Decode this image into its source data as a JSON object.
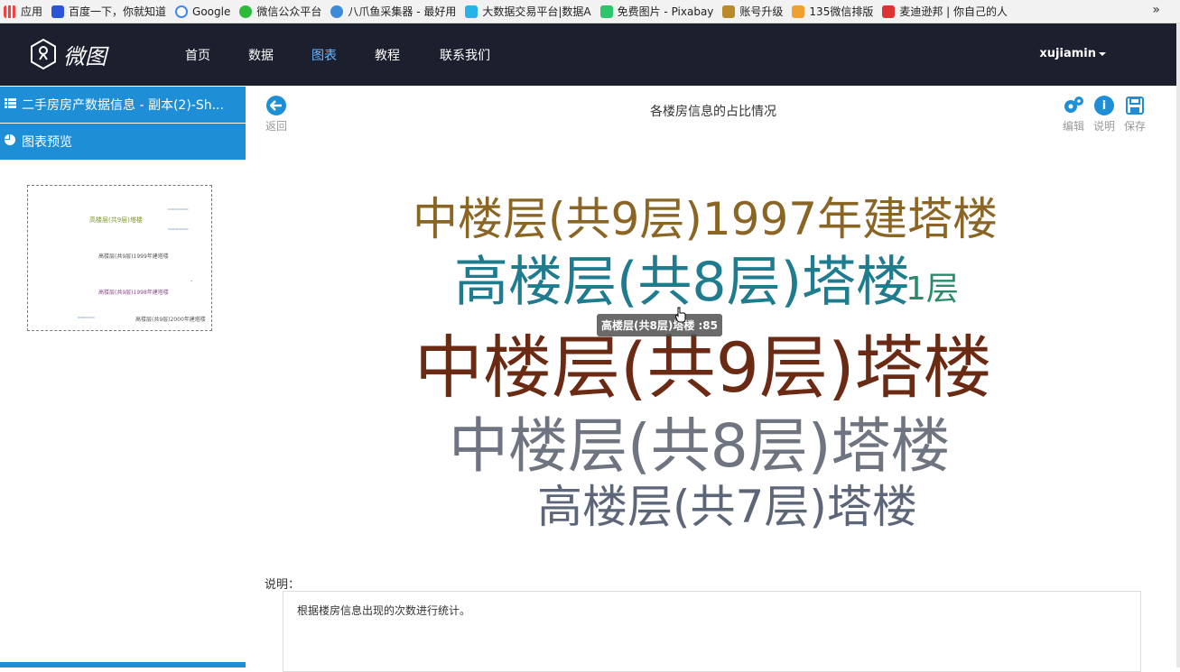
{
  "bookmarks": [
    {
      "label": "应用",
      "color": "#e44"
    },
    {
      "label": "百度一下，你就知道",
      "color": "#2b55d6"
    },
    {
      "label": "Google",
      "color": "#4285f4"
    },
    {
      "label": "微信公众平台",
      "color": "#2dbb3c"
    },
    {
      "label": "八爪鱼采集器 - 最好用",
      "color": "#3c8ad8"
    },
    {
      "label": "大数据交易平台|数据A",
      "color": "#2ab1e8"
    },
    {
      "label": "免费图片 - Pixabay",
      "color": "#2ec66d"
    },
    {
      "label": "账号升级",
      "color": "#b88a2a"
    },
    {
      "label": "135微信排版",
      "color": "#f0a030"
    },
    {
      "label": "麦迪逊邦 | 你自己的人",
      "color": "#d33"
    }
  ],
  "nav": {
    "logo_text": "微图",
    "links": [
      "首页",
      "数据",
      "图表",
      "教程",
      "联系我们"
    ],
    "active": "图表",
    "user": "xujiamin"
  },
  "sidebar": {
    "dataset_title": "二手房房产数据信息 - 副本(2)-Sh...",
    "preview_label": "图表预览",
    "thumb_words": [
      "高楼层(共9层)塔楼",
      "高楼层(共9层)1999年建塔楼",
      "高楼层(共9层)1998年建塔楼",
      "高楼层(共9层)2000年建塔楼"
    ]
  },
  "toolbar": {
    "back_label": "返回",
    "title": "各楼房信息的占比情况",
    "edit_label": "编辑",
    "desc_label": "说明",
    "save_label": "保存"
  },
  "chart_data": {
    "type": "wordcloud",
    "title": "各楼房信息的占比情况",
    "words": [
      {
        "text": "中楼层(共9层)1997年建塔楼",
        "color": "#8b6524"
      },
      {
        "text": "高楼层(共8层)塔楼",
        "color": "#1e7c8e",
        "value": 85
      },
      {
        "text": "1层",
        "color": "#2a8a6a"
      },
      {
        "text": "中楼层(共9层)塔楼",
        "color": "#6b2a14"
      },
      {
        "text": "中楼层(共8层)塔楼",
        "color": "#6e7480"
      },
      {
        "text": "高楼层(共7层)塔楼",
        "color": "#5c6678"
      }
    ],
    "tooltip": "高楼层(共8层)塔楼 :85"
  },
  "description": {
    "label": "说明：",
    "text": "根据楼房信息出现的次数进行统计。"
  }
}
